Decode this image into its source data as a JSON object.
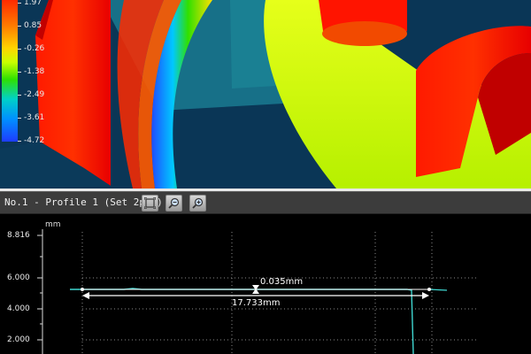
{
  "colorbar": {
    "labels": [
      "1.97",
      "0.85",
      "-0.26",
      "-1.38",
      "-2.49",
      "-3.61",
      "-4.72"
    ]
  },
  "profile": {
    "title": "No.1 - Profile 1 (Set 2pt.)",
    "toolbar": {
      "fit_icon": "fit-to-window-icon",
      "zoom_out_icon": "zoom-out-icon",
      "zoom_in_icon": "zoom-in-icon"
    }
  },
  "graph": {
    "unit": "mm",
    "y_labels": [
      "8.816",
      "6.000",
      "4.000",
      "2.000"
    ],
    "height_label": "0.035mm",
    "width_label": "17.733mm"
  },
  "colors": {
    "profile_line": "#3fd6d0",
    "grid": "#8a8a8a",
    "toolbar_bg": "#3c3c3c"
  }
}
